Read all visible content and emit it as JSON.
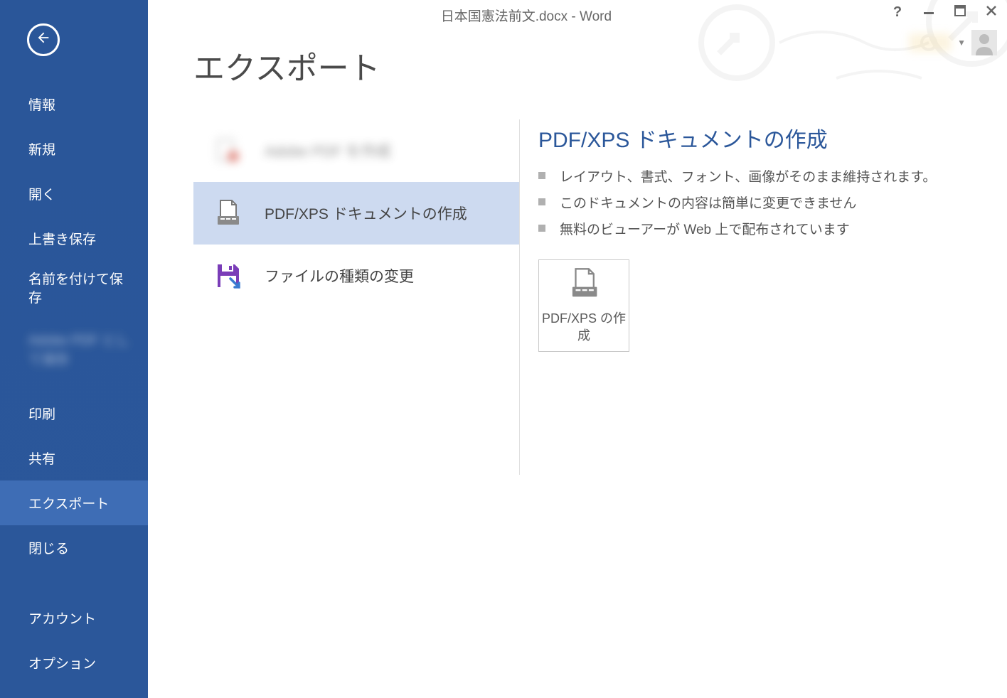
{
  "window": {
    "title": "日本国憲法前文.docx - Word"
  },
  "sidebar": {
    "items": [
      {
        "label": "情報"
      },
      {
        "label": "新規"
      },
      {
        "label": "開く"
      },
      {
        "label": "上書き保存"
      },
      {
        "label": "名前を付けて保存"
      },
      {
        "label": "Adobe PDF として保存"
      },
      {
        "label": "印刷"
      },
      {
        "label": "共有"
      },
      {
        "label": "エクスポート"
      },
      {
        "label": "閉じる"
      },
      {
        "label": "アカウント"
      },
      {
        "label": "オプション"
      }
    ],
    "selected_index": 8
  },
  "page": {
    "heading": "エクスポート"
  },
  "export_options": [
    {
      "label": "Adobe PDF を作成",
      "icon": "adobe-pdf-icon",
      "blurred": true
    },
    {
      "label": "PDF/XPS ドキュメントの作成",
      "icon": "pdf-xps-icon",
      "selected": true
    },
    {
      "label": "ファイルの種類の変更",
      "icon": "save-as-icon"
    }
  ],
  "details": {
    "heading": "PDF/XPS ドキュメントの作成",
    "bullets": [
      "レイアウト、書式、フォント、画像がそのまま維持されます。",
      "このドキュメントの内容は簡単に変更できません",
      "無料のビューアーが Web 上で配布されています"
    ],
    "action_button": "PDF/XPS の作成"
  }
}
